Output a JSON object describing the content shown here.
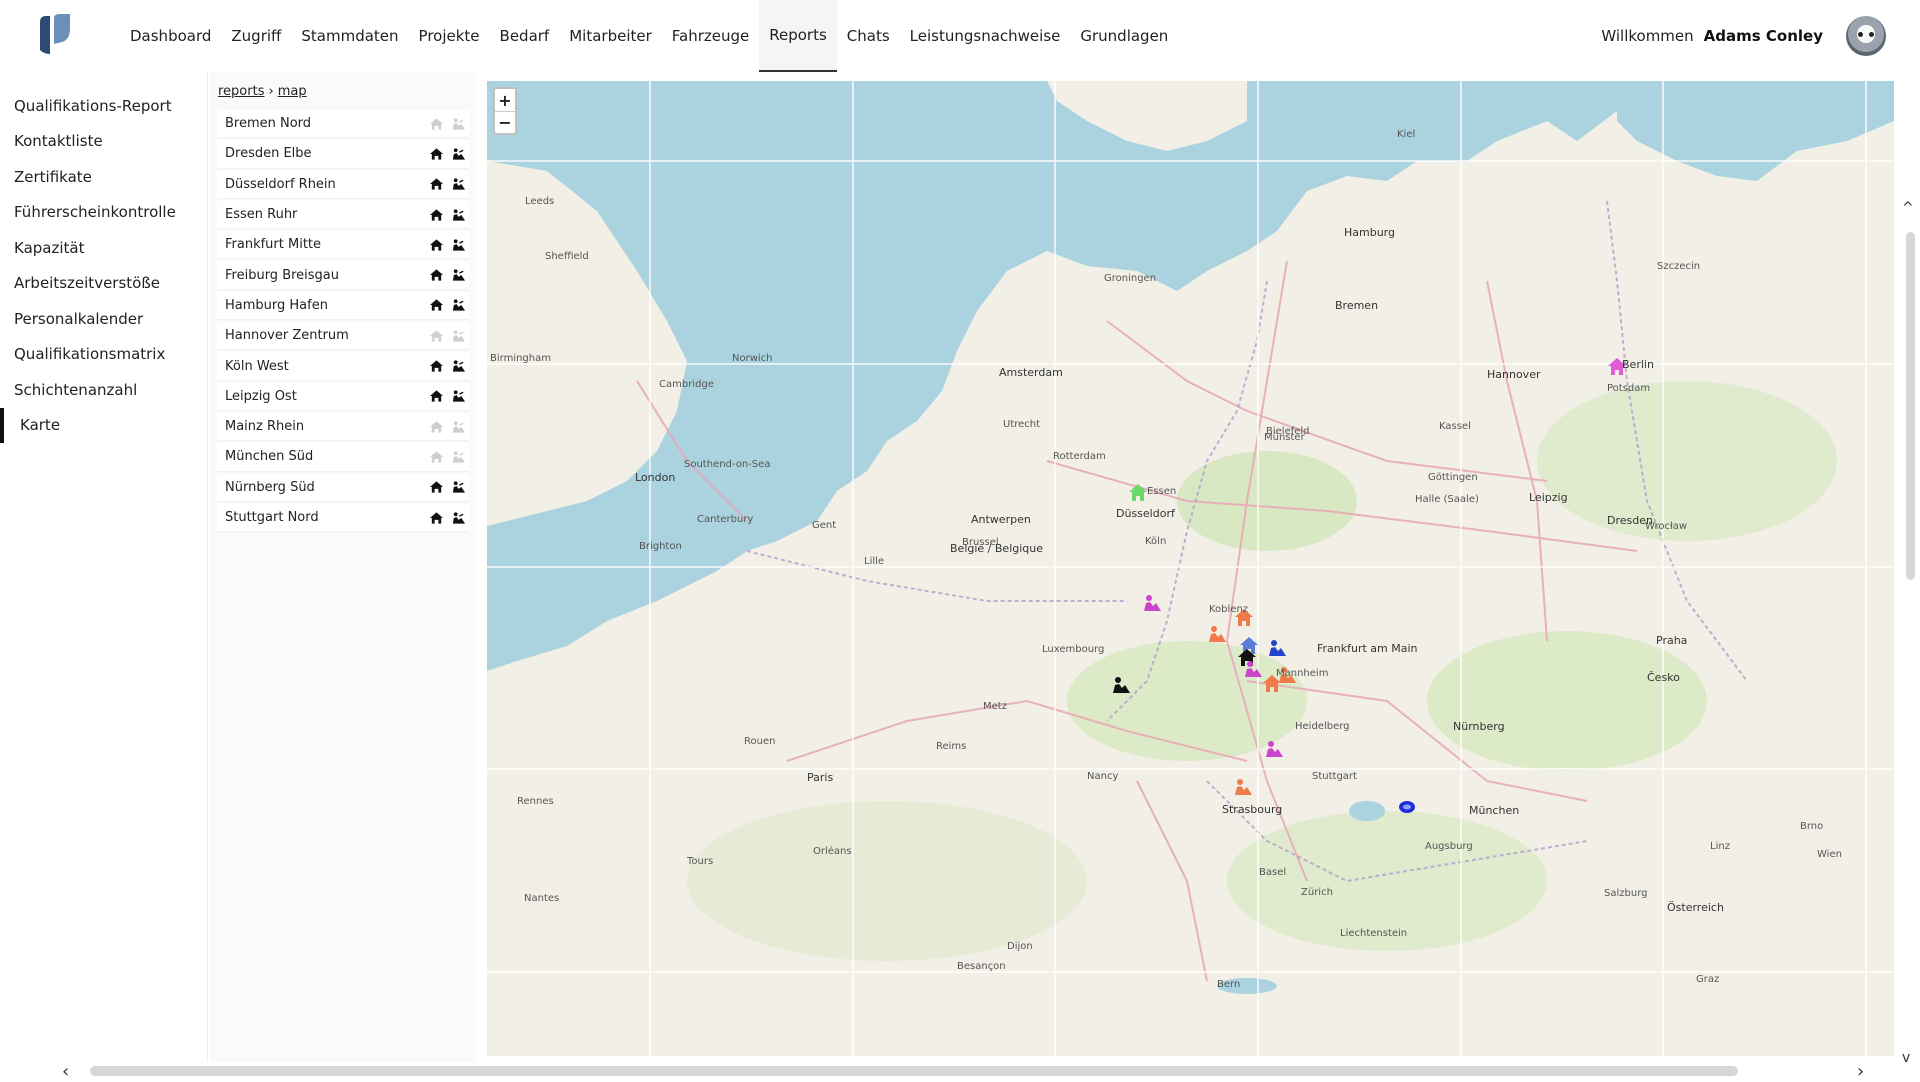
{
  "nav": {
    "items": [
      "Dashboard",
      "Zugriff",
      "Stammdaten",
      "Projekte",
      "Bedarf",
      "Mitarbeiter",
      "Fahrzeuge",
      "Reports",
      "Chats",
      "Leistungsnachweise",
      "Grundlagen"
    ],
    "active": "Reports"
  },
  "user": {
    "welcome": "Willkommen",
    "name": "Adams Conley"
  },
  "sidebar": {
    "items": [
      "Qualifikations-Report",
      "Kontaktliste",
      "Zertifikate",
      "Führerscheinkontrolle",
      "Kapazität",
      "Arbeitszeitverstöße",
      "Personalkalender",
      "Qualifikationsmatrix",
      "Schichtenanzahl",
      "Karte"
    ],
    "active": "Karte"
  },
  "breadcrumb": {
    "parent": "reports",
    "separator": "›",
    "current": "map"
  },
  "sites": [
    {
      "name": "Bremen Nord",
      "enabled": false
    },
    {
      "name": "Dresden Elbe",
      "enabled": true
    },
    {
      "name": "Düsseldorf Rhein",
      "enabled": true
    },
    {
      "name": "Essen Ruhr",
      "enabled": true
    },
    {
      "name": "Frankfurt Mitte",
      "enabled": true
    },
    {
      "name": "Freiburg Breisgau",
      "enabled": true
    },
    {
      "name": "Hamburg Hafen",
      "enabled": true
    },
    {
      "name": "Hannover Zentrum",
      "enabled": false
    },
    {
      "name": "Köln West",
      "enabled": true
    },
    {
      "name": "Leipzig Ost",
      "enabled": true
    },
    {
      "name": "Mainz Rhein",
      "enabled": false
    },
    {
      "name": "München Süd",
      "enabled": false
    },
    {
      "name": "Nürnberg Süd",
      "enabled": true
    },
    {
      "name": "Stuttgart Nord",
      "enabled": true
    }
  ],
  "map": {
    "zoom_in": "+",
    "zoom_out": "−",
    "cities": [
      {
        "name": "Kiel",
        "big": false
      },
      {
        "name": "Hamburg",
        "big": true
      },
      {
        "name": "Bremen",
        "big": true
      },
      {
        "name": "Groningen",
        "big": false
      },
      {
        "name": "Amsterdam",
        "big": true
      },
      {
        "name": "Hannover",
        "big": true
      },
      {
        "name": "Berlin",
        "big": true
      },
      {
        "name": "Szczecin",
        "big": false
      },
      {
        "name": "Potsdam",
        "big": false
      },
      {
        "name": "Leeds",
        "big": false
      },
      {
        "name": "Sheffield",
        "big": false
      },
      {
        "name": "Birmingham",
        "big": false
      },
      {
        "name": "Norwich",
        "big": false
      },
      {
        "name": "Cambridge",
        "big": false
      },
      {
        "name": "London",
        "big": true
      },
      {
        "name": "Southend-on-Sea",
        "big": false
      },
      {
        "name": "Brighton",
        "big": false
      },
      {
        "name": "Canterbury",
        "big": false
      },
      {
        "name": "Utrecht",
        "big": false
      },
      {
        "name": "Rotterdam",
        "big": false
      },
      {
        "name": "Antwerpen",
        "big": true
      },
      {
        "name": "Belgie / Belgique",
        "big": true
      },
      {
        "name": "Brussel",
        "big": false
      },
      {
        "name": "Gent",
        "big": false
      },
      {
        "name": "Lille",
        "big": false
      },
      {
        "name": "Düsseldorf",
        "big": true
      },
      {
        "name": "Köln",
        "big": false
      },
      {
        "name": "Essen",
        "big": false
      },
      {
        "name": "Bielefeld",
        "big": false
      },
      {
        "name": "Münster",
        "big": false
      },
      {
        "name": "Kassel",
        "big": false
      },
      {
        "name": "Göttingen",
        "big": false
      },
      {
        "name": "Halle (Saale)",
        "big": false
      },
      {
        "name": "Leipzig",
        "big": true
      },
      {
        "name": "Dresden",
        "big": true
      },
      {
        "name": "Wrocław",
        "big": false
      },
      {
        "name": "Koblenz",
        "big": false
      },
      {
        "name": "Frankfurt am Main",
        "big": true
      },
      {
        "name": "Luxembourg",
        "big": false
      },
      {
        "name": "Mannheim",
        "big": false
      },
      {
        "name": "Heidelberg",
        "big": false
      },
      {
        "name": "Nürnberg",
        "big": true
      },
      {
        "name": "Praha",
        "big": true
      },
      {
        "name": "Česko",
        "big": true
      },
      {
        "name": "Paris",
        "big": true
      },
      {
        "name": "Reims",
        "big": false
      },
      {
        "name": "Rouen",
        "big": false
      },
      {
        "name": "Rennes",
        "big": false
      },
      {
        "name": "Orléans",
        "big": false
      },
      {
        "name": "Tours",
        "big": false
      },
      {
        "name": "Nantes",
        "big": false
      },
      {
        "name": "Metz",
        "big": false
      },
      {
        "name": "Nancy",
        "big": false
      },
      {
        "name": "Strasbourg",
        "big": true
      },
      {
        "name": "Stuttgart",
        "big": false
      },
      {
        "name": "Augsburg",
        "big": false
      },
      {
        "name": "München",
        "big": true
      },
      {
        "name": "Zürich",
        "big": false
      },
      {
        "name": "Bern",
        "big": false
      },
      {
        "name": "Basel",
        "big": false
      },
      {
        "name": "Dijon",
        "big": false
      },
      {
        "name": "Besançon",
        "big": false
      },
      {
        "name": "Linz",
        "big": false
      },
      {
        "name": "Salzburg",
        "big": false
      },
      {
        "name": "Österreich",
        "big": true
      },
      {
        "name": "Liechtenstein",
        "big": false
      },
      {
        "name": "Graz",
        "big": false
      },
      {
        "name": "Wien",
        "big": false
      },
      {
        "name": "Brno",
        "big": false
      }
    ],
    "markers": [
      {
        "kind": "house",
        "color": "#e05bd6"
      },
      {
        "kind": "house",
        "color": "#6cd86c"
      },
      {
        "kind": "worker",
        "color": "#cc44cc"
      },
      {
        "kind": "house",
        "color": "#f07a4a"
      },
      {
        "kind": "worker",
        "color": "#f07a4a"
      },
      {
        "kind": "house",
        "color": "#5a7fd8"
      },
      {
        "kind": "house",
        "color": "#111111"
      },
      {
        "kind": "worker",
        "color": "#2244cc"
      },
      {
        "kind": "worker",
        "color": "#cc44cc"
      },
      {
        "kind": "worker",
        "color": "#f07a4a"
      },
      {
        "kind": "house",
        "color": "#f07a4a"
      },
      {
        "kind": "worker",
        "color": "#111111"
      },
      {
        "kind": "worker",
        "color": "#cc44cc"
      },
      {
        "kind": "worker",
        "color": "#f07a4a"
      },
      {
        "kind": "blob",
        "color": "#1f2fd8"
      }
    ]
  },
  "colors": {
    "water": "#aad3df",
    "land": "#f2efe6",
    "forest": "#cde6b4",
    "road": "#e8a9b8",
    "accent": "#111111"
  },
  "icons": {
    "home": "home-icon",
    "worker": "worker-icon",
    "logo": "app-logo-icon"
  }
}
